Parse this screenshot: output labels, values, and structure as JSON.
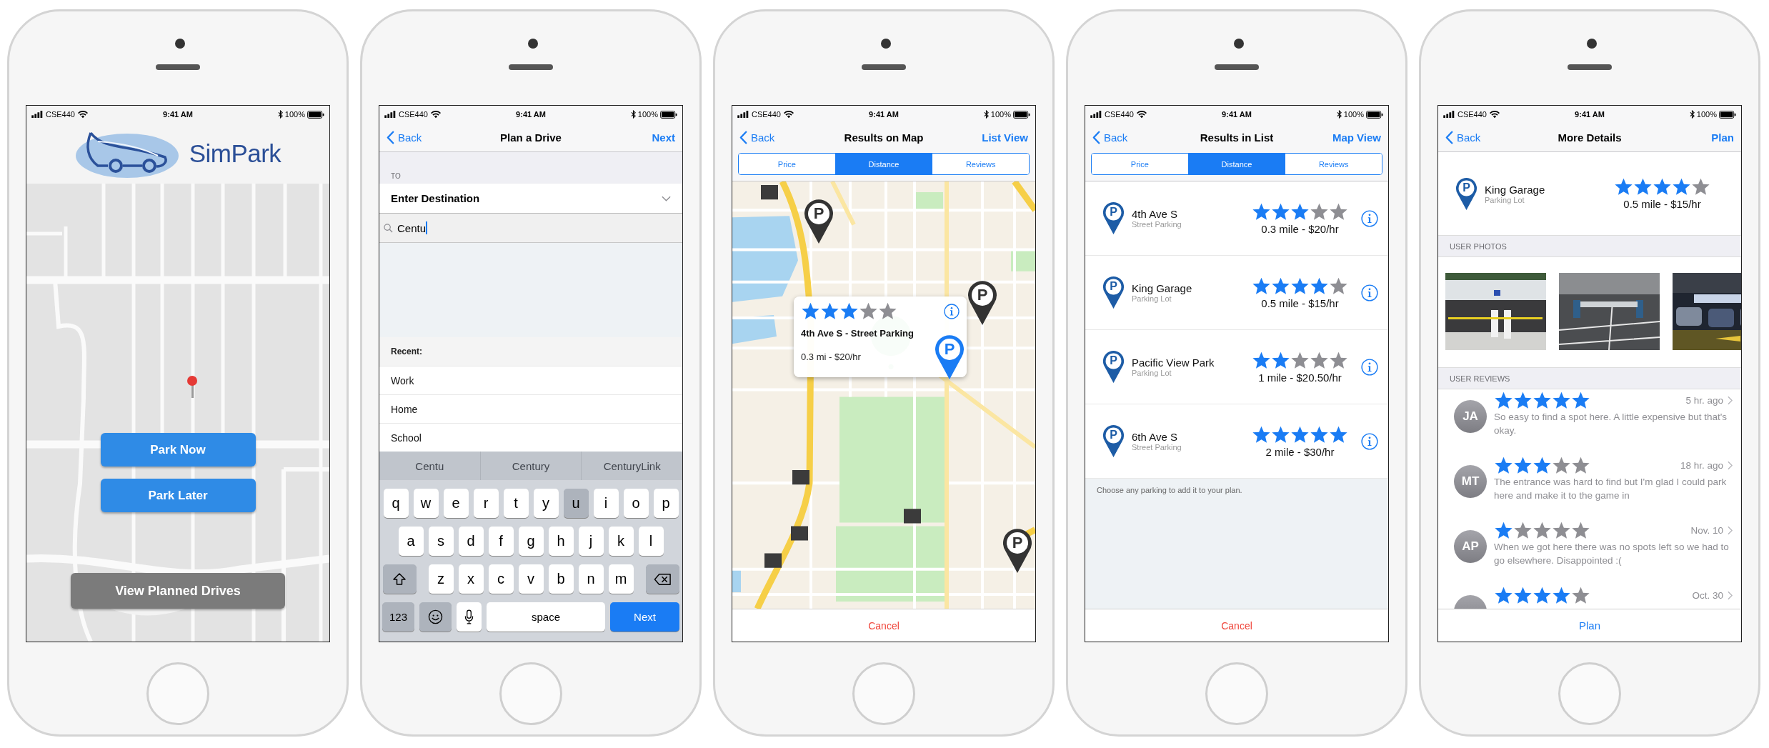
{
  "phones": [
    {
      "kind": "home",
      "status_bar": {
        "carrier": "CSE440",
        "time": "9:41 AM",
        "battery": "100%"
      },
      "logo": {
        "name": "SimPark"
      },
      "buttons": [
        {
          "label": "Park Now",
          "kind": "primary"
        },
        {
          "label": "Park Later",
          "kind": "primary"
        },
        {
          "label": "View Planned Drives",
          "kind": "secondary"
        }
      ]
    },
    {
      "kind": "plan",
      "status_bar": {
        "carrier": "CSE440",
        "time": "9:41 AM",
        "battery": "100%"
      },
      "nav": {
        "back": "Back",
        "title": "Plan a Drive",
        "action": "Next"
      },
      "section_label": "TO",
      "destination": {
        "label": "Enter Destination"
      },
      "search": {
        "value": "Centu"
      },
      "recent": {
        "header": "Recent:",
        "items": [
          "Work",
          "Home",
          "School"
        ]
      },
      "keyboard": {
        "suggestions": [
          "Centu",
          "Century",
          "CenturyLink"
        ],
        "rows": [
          {
            "keys": [
              {
                "kind": "letter",
                "label": "q",
                "pressed": false
              },
              {
                "kind": "letter",
                "label": "w",
                "pressed": false
              },
              {
                "kind": "letter",
                "label": "e",
                "pressed": false
              },
              {
                "kind": "letter",
                "label": "r",
                "pressed": false
              },
              {
                "kind": "letter",
                "label": "t",
                "pressed": false
              },
              {
                "kind": "letter",
                "label": "y",
                "pressed": false
              },
              {
                "kind": "letter",
                "label": "u",
                "pressed": true
              },
              {
                "kind": "letter",
                "label": "i",
                "pressed": false
              },
              {
                "kind": "letter",
                "label": "o",
                "pressed": false
              },
              {
                "kind": "letter",
                "label": "p",
                "pressed": false
              }
            ]
          },
          {
            "keys": [
              {
                "kind": "letter",
                "label": "a",
                "pressed": false
              },
              {
                "kind": "letter",
                "label": "s",
                "pressed": false
              },
              {
                "kind": "letter",
                "label": "d",
                "pressed": false
              },
              {
                "kind": "letter",
                "label": "f",
                "pressed": false
              },
              {
                "kind": "letter",
                "label": "g",
                "pressed": false
              },
              {
                "kind": "letter",
                "label": "h",
                "pressed": false
              },
              {
                "kind": "letter",
                "label": "j",
                "pressed": false
              },
              {
                "kind": "letter",
                "label": "k",
                "pressed": false
              },
              {
                "kind": "letter",
                "label": "l",
                "pressed": false
              }
            ]
          },
          {
            "keys": [
              {
                "kind": "shift",
                "pressed": false
              },
              {
                "kind": "letter",
                "label": "z",
                "pressed": false
              },
              {
                "kind": "letter",
                "label": "x",
                "pressed": false
              },
              {
                "kind": "letter",
                "label": "c",
                "pressed": false
              },
              {
                "kind": "letter",
                "label": "v",
                "pressed": false
              },
              {
                "kind": "letter",
                "label": "b",
                "pressed": false
              },
              {
                "kind": "letter",
                "label": "n",
                "pressed": false
              },
              {
                "kind": "letter",
                "label": "m",
                "pressed": false
              },
              {
                "kind": "backspace",
                "pressed": false
              }
            ]
          },
          {
            "keys": [
              {
                "kind": "mode",
                "label": "123",
                "pressed": false
              },
              {
                "kind": "emoji",
                "pressed": false
              },
              {
                "kind": "mic",
                "pressed": false
              },
              {
                "kind": "space",
                "label": "space",
                "pressed": false
              },
              {
                "kind": "return",
                "label": "Next",
                "pressed": false
              }
            ]
          }
        ]
      }
    },
    {
      "kind": "map_results",
      "status_bar": {
        "carrier": "CSE440",
        "time": "9:41 AM",
        "battery": "100%"
      },
      "nav": {
        "back": "Back",
        "title": "Results on Map",
        "action": "List View"
      },
      "segments": [
        {
          "label": "Price",
          "selected": false
        },
        {
          "label": "Distance",
          "selected": true
        },
        {
          "label": "Reviews",
          "selected": false
        }
      ],
      "popup": {
        "stars": 3,
        "title": "4th Ave S - Street Parking",
        "detail": "0.3 mi - $20/hr"
      },
      "map_pins": [
        {
          "label": "P",
          "selected": false
        },
        {
          "label": "P",
          "selected": false
        },
        {
          "label": "P",
          "selected": true
        },
        {
          "label": "P",
          "selected": false
        }
      ],
      "footer_button": {
        "label": "Cancel",
        "kind": "destructive"
      }
    },
    {
      "kind": "list_results",
      "status_bar": {
        "carrier": "CSE440",
        "time": "9:41 AM",
        "battery": "100%"
      },
      "nav": {
        "back": "Back",
        "title": "Results in List",
        "action": "Map View"
      },
      "segments": [
        {
          "label": "Price",
          "selected": false
        },
        {
          "label": "Distance",
          "selected": true
        },
        {
          "label": "Reviews",
          "selected": false
        }
      ],
      "results": [
        {
          "pin": "P",
          "name": "4th Ave S",
          "type": "Street Parking",
          "stars": 3,
          "detail": "0.3 mile - $20/hr"
        },
        {
          "pin": "P",
          "name": "King Garage",
          "type": "Parking Lot",
          "stars": 4,
          "detail": "0.5 mile - $15/hr"
        },
        {
          "pin": "P",
          "name": "Pacific View Park",
          "type": "Parking Lot",
          "stars": 2,
          "detail": "1 mile - $20.50/hr"
        },
        {
          "pin": "P",
          "name": "6th Ave S",
          "type": "Street Parking",
          "stars": 5,
          "detail": "2 mile - $30/hr"
        }
      ],
      "hint": "Choose any parking to add it to your plan.",
      "footer_button": {
        "label": "Cancel",
        "kind": "destructive"
      }
    },
    {
      "kind": "details",
      "status_bar": {
        "carrier": "CSE440",
        "time": "9:41 AM",
        "battery": "100%"
      },
      "nav": {
        "back": "Back",
        "title": "More Details",
        "action": "Plan"
      },
      "place": {
        "pin": "P",
        "name": "King Garage",
        "type": "Parking Lot",
        "stars": 4,
        "detail": "0.5 mile - $15/hr"
      },
      "photos_header": "USER PHOTOS",
      "photos": [
        {
          "kind": "picture"
        },
        {
          "kind": "picture"
        },
        {
          "kind": "picture"
        }
      ],
      "reviews_header": "USER REVIEWS",
      "reviews": [
        {
          "initials": "JA",
          "stars": 5,
          "time": "5 hr. ago",
          "text": "So easy to find a spot here. A little expensive but that's okay."
        },
        {
          "initials": "MT",
          "stars": 3,
          "time": "18 hr. ago",
          "text": "The entrance was hard to find but I'm glad I could park here and make it to the game in"
        },
        {
          "initials": "AP",
          "stars": 1,
          "time": "Nov. 10",
          "text": "When we got here there was no spots left so we had to go elsewhere. Disappointed :("
        },
        {
          "stars": 4,
          "time": "Oct. 30"
        }
      ],
      "footer_button": {
        "label": "Plan",
        "kind": "primary"
      }
    }
  ]
}
